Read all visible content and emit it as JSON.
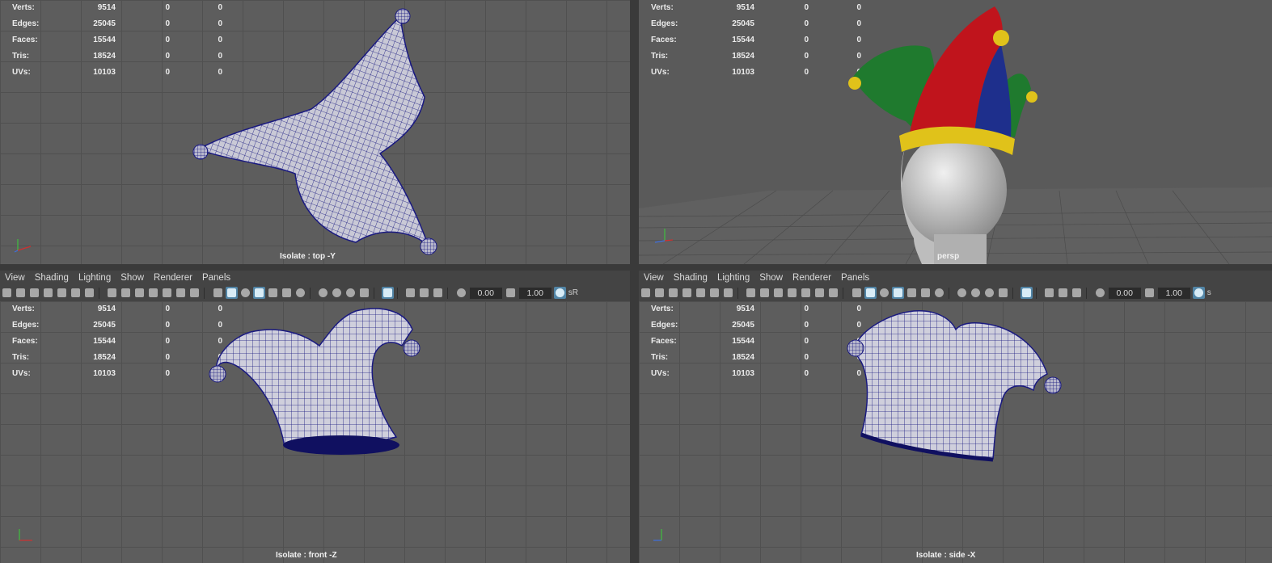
{
  "stats": [
    {
      "label": "Verts:",
      "v1": "9514",
      "v2": "0",
      "v3": "0"
    },
    {
      "label": "Edges:",
      "v1": "25045",
      "v2": "0",
      "v3": "0"
    },
    {
      "label": "Faces:",
      "v1": "15544",
      "v2": "0",
      "v3": "0"
    },
    {
      "label": "Tris:",
      "v1": "18524",
      "v2": "0",
      "v3": "0"
    },
    {
      "label": "UVs:",
      "v1": "10103",
      "v2": "0",
      "v3": "0"
    }
  ],
  "viewports": {
    "top_left": {
      "caption": "Isolate : top -Y"
    },
    "top_right": {
      "caption": "persp"
    },
    "bottom_left": {
      "caption": "Isolate : front -Z"
    },
    "bottom_right": {
      "caption": "Isolate : side -X"
    }
  },
  "menu": {
    "items": [
      "View",
      "Shading",
      "Lighting",
      "Show",
      "Renderer",
      "Panels"
    ]
  },
  "toolbar": {
    "exposure": "0.00",
    "gamma": "1.00",
    "colorspace_left": "sR",
    "colorspace_right": "s"
  },
  "axes": {
    "y": "y",
    "z": "z",
    "x": "x"
  },
  "colors": {
    "wire": "#1a1a80",
    "grid": "#505050",
    "bg": "#5d5d5d",
    "active_icon": "#5285a6",
    "hat_red": "#c0141c",
    "hat_green": "#1f7a2e",
    "hat_blue": "#1e2f8c",
    "hat_gold": "#e0c21a"
  }
}
